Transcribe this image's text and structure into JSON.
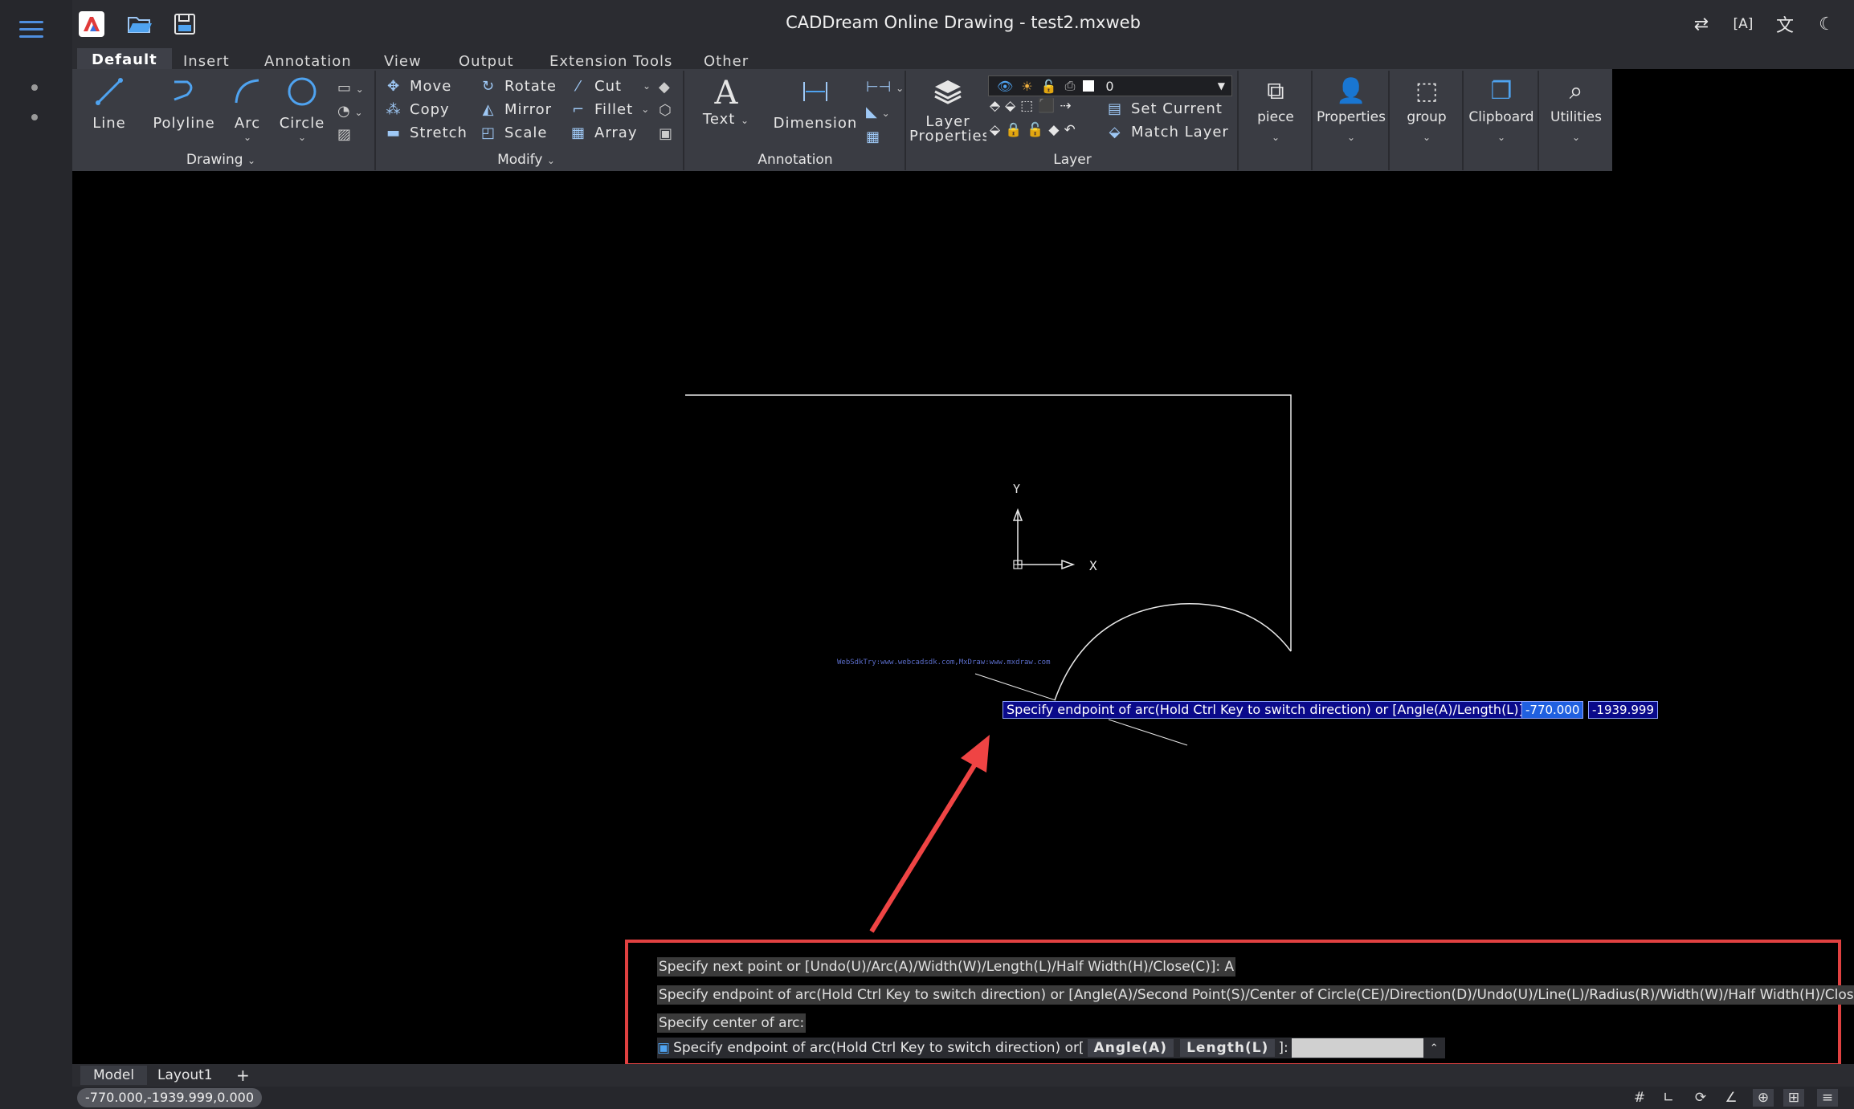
{
  "app": {
    "title": "CADDream Online Drawing - test2.mxweb"
  },
  "tabs": [
    {
      "label": "Default",
      "active": true
    },
    {
      "label": "Insert"
    },
    {
      "label": "Annotation"
    },
    {
      "label": "View"
    },
    {
      "label": "Output"
    },
    {
      "label": "Extension Tools"
    },
    {
      "label": "Other"
    }
  ],
  "ribbon": {
    "drawing": {
      "line": "Line",
      "polyline": "Polyline",
      "arc": "Arc",
      "circle": "Circle",
      "group": "Drawing"
    },
    "modify": {
      "move": "Move",
      "copy": "Copy",
      "stretch": "Stretch",
      "rotate": "Rotate",
      "mirror": "Mirror",
      "scale": "Scale",
      "cut": "Cut",
      "fillet": "Fillet",
      "array": "Array",
      "group": "Modify"
    },
    "annotation": {
      "text": "Text",
      "dimension": "Dimension",
      "group": "Annotation"
    },
    "layer": {
      "properties": "Layer Properties",
      "current_layer": "0",
      "set_current": "Set Current",
      "match_layer": "Match Layer",
      "group": "Layer"
    },
    "piece": "piece",
    "properties": "Properties",
    "group_btn": "group",
    "clipboard": "Clipboard",
    "utilities": "Utilities"
  },
  "canvas": {
    "watermark": "WebSdkTry:www.webcadsdk.com,MxDraw:www.mxdraw.com",
    "ucs_x": "X",
    "ucs_y": "Y",
    "prompt": "Specify endpoint of arc(Hold Ctrl Key to switch direction) or [Angle(A)/Length(L)]:",
    "input_x": "-770.000",
    "input_y": "-1939.999"
  },
  "command_history": [
    "Specify next point or [Undo(U)/Arc(A)/Width(W)/Length(L)/Half Width(H)/Close(C)]: A",
    "Specify endpoint of arc(Hold Ctrl Key to switch direction) or [Angle(A)/Second Point(S)/Center of Circle(CE)/Direction(D)/Undo(U)/Line(L)/Radius(R)/Width(W)/Half Width(H)/Close(C)]: CE",
    "Specify center of arc:"
  ],
  "command_line": {
    "prompt": "Specify endpoint of arc(Hold Ctrl Key to switch direction) or[",
    "opt1": "Angle(A)",
    "opt2": "Length(L)",
    "suffix": "]:",
    "input_value": ""
  },
  "bottom_tabs": [
    {
      "label": "Model",
      "active": true
    },
    {
      "label": "Layout1"
    }
  ],
  "add_layout": "+",
  "status": {
    "coordinates": "-770.000,-1939.999,0.000"
  },
  "colors": {
    "accent": "#4fa3f0",
    "highlight_border": "#e04141",
    "arrow": "#ef4444"
  }
}
